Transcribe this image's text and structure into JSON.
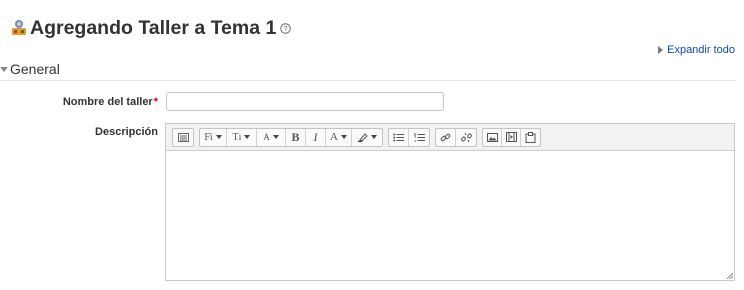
{
  "page": {
    "title": "Agregando Taller a Tema 1",
    "expand_all": "Expandir todo"
  },
  "section": {
    "legend": "General"
  },
  "form": {
    "name_label": "Nombre del taller",
    "name_required_mark": "*",
    "name_value": "",
    "description_label": "Descripción",
    "description_value": ""
  },
  "toolbar": {
    "font_family_label": "Fi",
    "font_size_label": "Tı",
    "paragraph_label": "A",
    "bold_label": "B",
    "italic_label": "I",
    "text_color_label": "A"
  },
  "icons": {
    "title": "workshop-icon",
    "help": "help-icon",
    "toolbar": [
      "show-more-icon",
      "font-family-icon",
      "font-size-icon",
      "paragraph-style-icon",
      "bold-icon",
      "italic-icon",
      "text-color-icon",
      "highlight-color-icon",
      "unordered-list-icon",
      "ordered-list-icon",
      "link-icon",
      "unlink-icon",
      "image-icon",
      "media-icon",
      "manage-files-icon"
    ]
  }
}
